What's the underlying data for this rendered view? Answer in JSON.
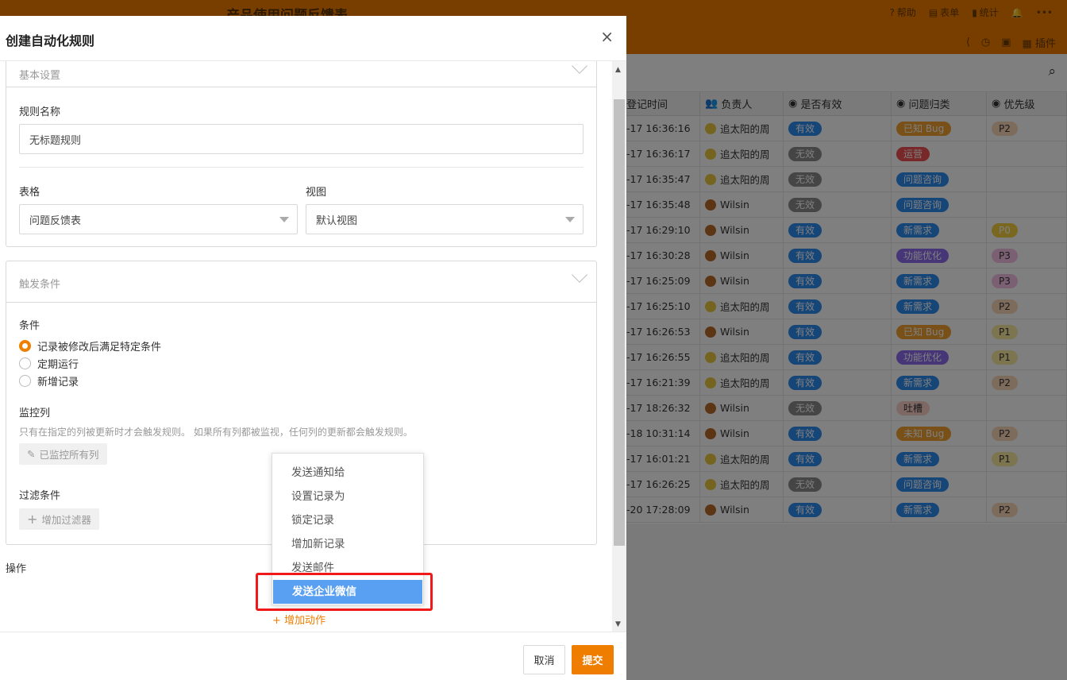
{
  "app": {
    "title": "产品使用问题反馈表",
    "top_actions": [
      "帮助",
      "表单",
      "统计"
    ],
    "plugin_label": "插件"
  },
  "grid": {
    "headers": [
      "登记时间",
      "负责人",
      "是否有效",
      "问题归类",
      "优先级"
    ],
    "rows": [
      {
        "time": "-17 16:36:16",
        "owner": "追太阳的周",
        "owner_avatar": "sun",
        "valid": "有效",
        "valid_c": "p-blue",
        "cat": "已知 Bug",
        "cat_c": "p-org",
        "pri": "P2",
        "pri_c": "p-peach"
      },
      {
        "time": "-17 16:36:17",
        "owner": "追太阳的周",
        "owner_avatar": "sun",
        "valid": "无效",
        "valid_c": "p-gray",
        "cat": "运营",
        "cat_c": "p-red",
        "pri": "",
        "pri_c": ""
      },
      {
        "time": "-17 16:35:47",
        "owner": "追太阳的周",
        "owner_avatar": "sun",
        "valid": "无效",
        "valid_c": "p-gray",
        "cat": "问题咨询",
        "cat_c": "p-blue",
        "pri": "",
        "pri_c": ""
      },
      {
        "time": "-17 16:35:48",
        "owner": "Wilsin",
        "owner_avatar": "w",
        "valid": "无效",
        "valid_c": "p-gray",
        "cat": "问题咨询",
        "cat_c": "p-blue",
        "pri": "",
        "pri_c": ""
      },
      {
        "time": "-17 16:29:10",
        "owner": "Wilsin",
        "owner_avatar": "w",
        "valid": "有效",
        "valid_c": "p-blue",
        "cat": "新需求",
        "cat_c": "p-blue",
        "pri": "P0",
        "pri_c": "p-yellow"
      },
      {
        "time": "-17 16:30:28",
        "owner": "Wilsin",
        "owner_avatar": "w",
        "valid": "有效",
        "valid_c": "p-blue",
        "cat": "功能优化",
        "cat_c": "p-purple",
        "pri": "P3",
        "pri_c": "p-pink"
      },
      {
        "time": "-17 16:25:09",
        "owner": "Wilsin",
        "owner_avatar": "w",
        "valid": "有效",
        "valid_c": "p-blue",
        "cat": "新需求",
        "cat_c": "p-blue",
        "pri": "P3",
        "pri_c": "p-pink"
      },
      {
        "time": "-17 16:25:10",
        "owner": "追太阳的周",
        "owner_avatar": "sun",
        "valid": "有效",
        "valid_c": "p-blue",
        "cat": "新需求",
        "cat_c": "p-blue",
        "pri": "P2",
        "pri_c": "p-peach"
      },
      {
        "time": "-17 16:26:53",
        "owner": "Wilsin",
        "owner_avatar": "w",
        "valid": "有效",
        "valid_c": "p-blue",
        "cat": "已知 Bug",
        "cat_c": "p-org",
        "pri": "P1",
        "pri_c": "p-yel2"
      },
      {
        "time": "-17 16:26:55",
        "owner": "追太阳的周",
        "owner_avatar": "sun",
        "valid": "有效",
        "valid_c": "p-blue",
        "cat": "功能优化",
        "cat_c": "p-purple",
        "pri": "P1",
        "pri_c": "p-yel2"
      },
      {
        "time": "-17 16:21:39",
        "owner": "追太阳的周",
        "owner_avatar": "sun",
        "valid": "有效",
        "valid_c": "p-blue",
        "cat": "新需求",
        "cat_c": "p-blue",
        "pri": "P2",
        "pri_c": "p-peach"
      },
      {
        "time": "-17 18:26:32",
        "owner": "Wilsin",
        "owner_avatar": "w",
        "valid": "无效",
        "valid_c": "p-gray",
        "cat": "吐槽",
        "cat_c": "p-ltred",
        "pri": "",
        "pri_c": ""
      },
      {
        "time": "-18 10:31:14",
        "owner": "Wilsin",
        "owner_avatar": "w",
        "valid": "有效",
        "valid_c": "p-blue",
        "cat": "未知 Bug",
        "cat_c": "p-org",
        "pri": "P2",
        "pri_c": "p-peach"
      },
      {
        "time": "-17 16:01:21",
        "owner": "追太阳的周",
        "owner_avatar": "sun",
        "valid": "有效",
        "valid_c": "p-blue",
        "cat": "新需求",
        "cat_c": "p-blue",
        "pri": "P1",
        "pri_c": "p-yel2"
      },
      {
        "time": "-17 16:26:25",
        "owner": "追太阳的周",
        "owner_avatar": "sun",
        "valid": "无效",
        "valid_c": "p-gray",
        "cat": "问题咨询",
        "cat_c": "p-blue",
        "pri": "",
        "pri_c": ""
      },
      {
        "time": "-20 17:28:09",
        "owner": "Wilsin",
        "owner_avatar": "w",
        "valid": "有效",
        "valid_c": "p-blue",
        "cat": "新需求",
        "cat_c": "p-blue",
        "pri": "P2",
        "pri_c": "p-peach"
      }
    ]
  },
  "modal": {
    "title": "创建自动化规则",
    "close_symbol": "×",
    "basic": {
      "title": "基本设置",
      "rule_name_label": "规则名称",
      "rule_name_value": "无标题规则",
      "table_label": "表格",
      "table_value": "问题反馈表",
      "view_label": "视图",
      "view_value": "默认视图"
    },
    "trigger": {
      "title": "触发条件",
      "condition_label": "条件",
      "options": [
        "记录被修改后满足特定条件",
        "定期运行",
        "新增记录"
      ],
      "selected_index": 0,
      "monitor_label": "监控列",
      "monitor_hint": "只有在指定的列被更新时才会触发规则。 如果所有列都被监视，任何列的更新都会触发规则。",
      "monitor_button": "已监控所有列",
      "filter_label": "过滤条件",
      "filter_button": "增加过滤器"
    },
    "operation_label": "操作",
    "add_action": "+ 增加动作",
    "action_menu": [
      "发送通知给",
      "设置记录为",
      "锁定记录",
      "增加新记录",
      "发送邮件",
      "发送企业微信"
    ],
    "action_menu_highlight": 5,
    "footer": {
      "cancel": "取消",
      "submit": "提交"
    }
  },
  "colors": {
    "accent": "#ef7d00",
    "highlight": "#5aa0f2",
    "annotation": "#f01818"
  }
}
